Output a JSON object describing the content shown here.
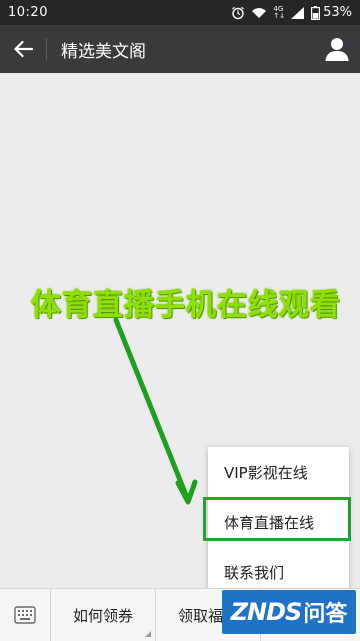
{
  "status_bar": {
    "time": "10:20",
    "network_type": "4G",
    "signal_sub": "↑↓",
    "battery_percent": "53%"
  },
  "header": {
    "title": "精选美文阁",
    "back_icon": "back-arrow-icon",
    "profile_icon": "user-icon"
  },
  "annotation": {
    "text": "体育直播手机在线观看",
    "color": "#8fe000",
    "highlight_color": "#22a52a"
  },
  "popup_menu": {
    "items": [
      {
        "label": "VIP影视在线"
      },
      {
        "label": "体育直播在线",
        "highlighted": true
      },
      {
        "label": "联系我们"
      }
    ]
  },
  "bottom_bar": {
    "keyboard_icon": "keyboard-icon",
    "menus": [
      {
        "label": "如何领券"
      },
      {
        "label": "领取福利"
      }
    ]
  },
  "watermark": {
    "part1": "ZNDS",
    "part2": "问答",
    "color": "#1e73c8"
  }
}
